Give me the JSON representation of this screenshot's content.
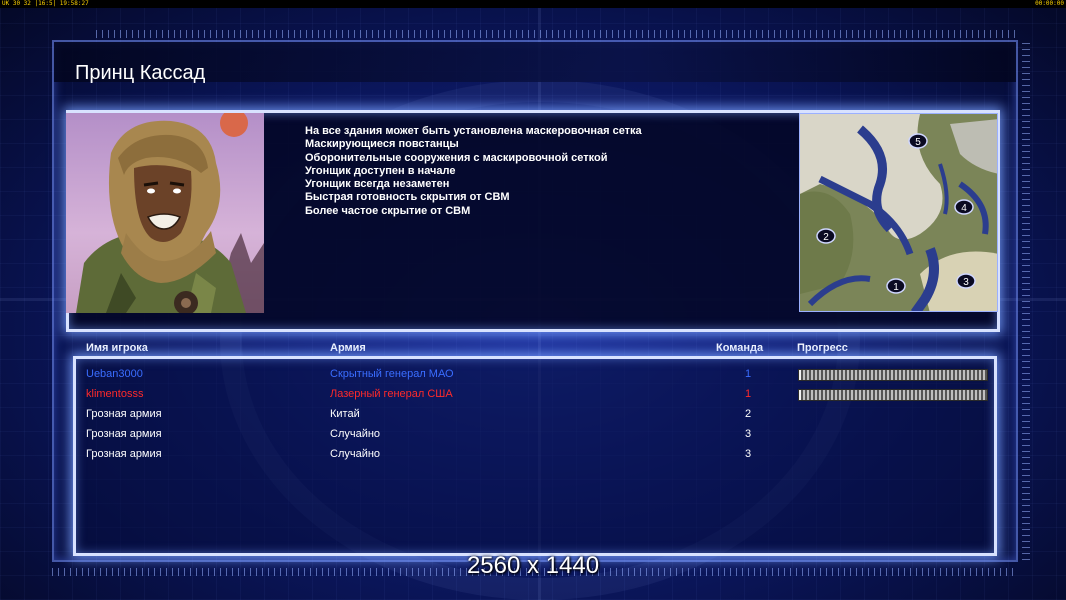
{
  "topbar": {
    "left_text": "UK 30 32 |16:5| 19:58:27",
    "right_text": "00:00:00"
  },
  "map": {
    "title": "Принц Кассад"
  },
  "faction": {
    "features": [
      "На все здания может быть установлена маскеровочная сетка",
      "Маскирующиеся повстанцы",
      "Оборонительные сооружения с маскировочной сеткой",
      "Угонщик доступен в начале",
      "Угонщик всегда незаметен",
      "Быстрая готовность скрытия от СВМ",
      "Более частое скрытие от СВМ"
    ]
  },
  "minimap": {
    "start_positions": [
      "5",
      "4",
      "2",
      "3",
      "1"
    ]
  },
  "table": {
    "headers": {
      "name": "Имя игрока",
      "army": "Армия",
      "team": "Команда",
      "progress": "Прогресс"
    },
    "rows": [
      {
        "name": "Ueban3000",
        "army": "Скрытный генерал МАО",
        "team": "1",
        "color": "#3a6dff",
        "progress": 0.01
      },
      {
        "name": "klimentosss",
        "army": "Лазерный генерал США",
        "team": "1",
        "color": "#ff2a2a",
        "progress": 0.01
      },
      {
        "name": "Грозная армия",
        "army": "Китай",
        "team": "2",
        "color": "#ffffff",
        "progress": null
      },
      {
        "name": "Грозная армия",
        "army": "Случайно",
        "team": "3",
        "color": "#ffffff",
        "progress": null
      },
      {
        "name": "Грозная армия",
        "army": "Случайно",
        "team": "3",
        "color": "#ffffff",
        "progress": null
      }
    ]
  },
  "resolution_label": "2560 x 1440"
}
